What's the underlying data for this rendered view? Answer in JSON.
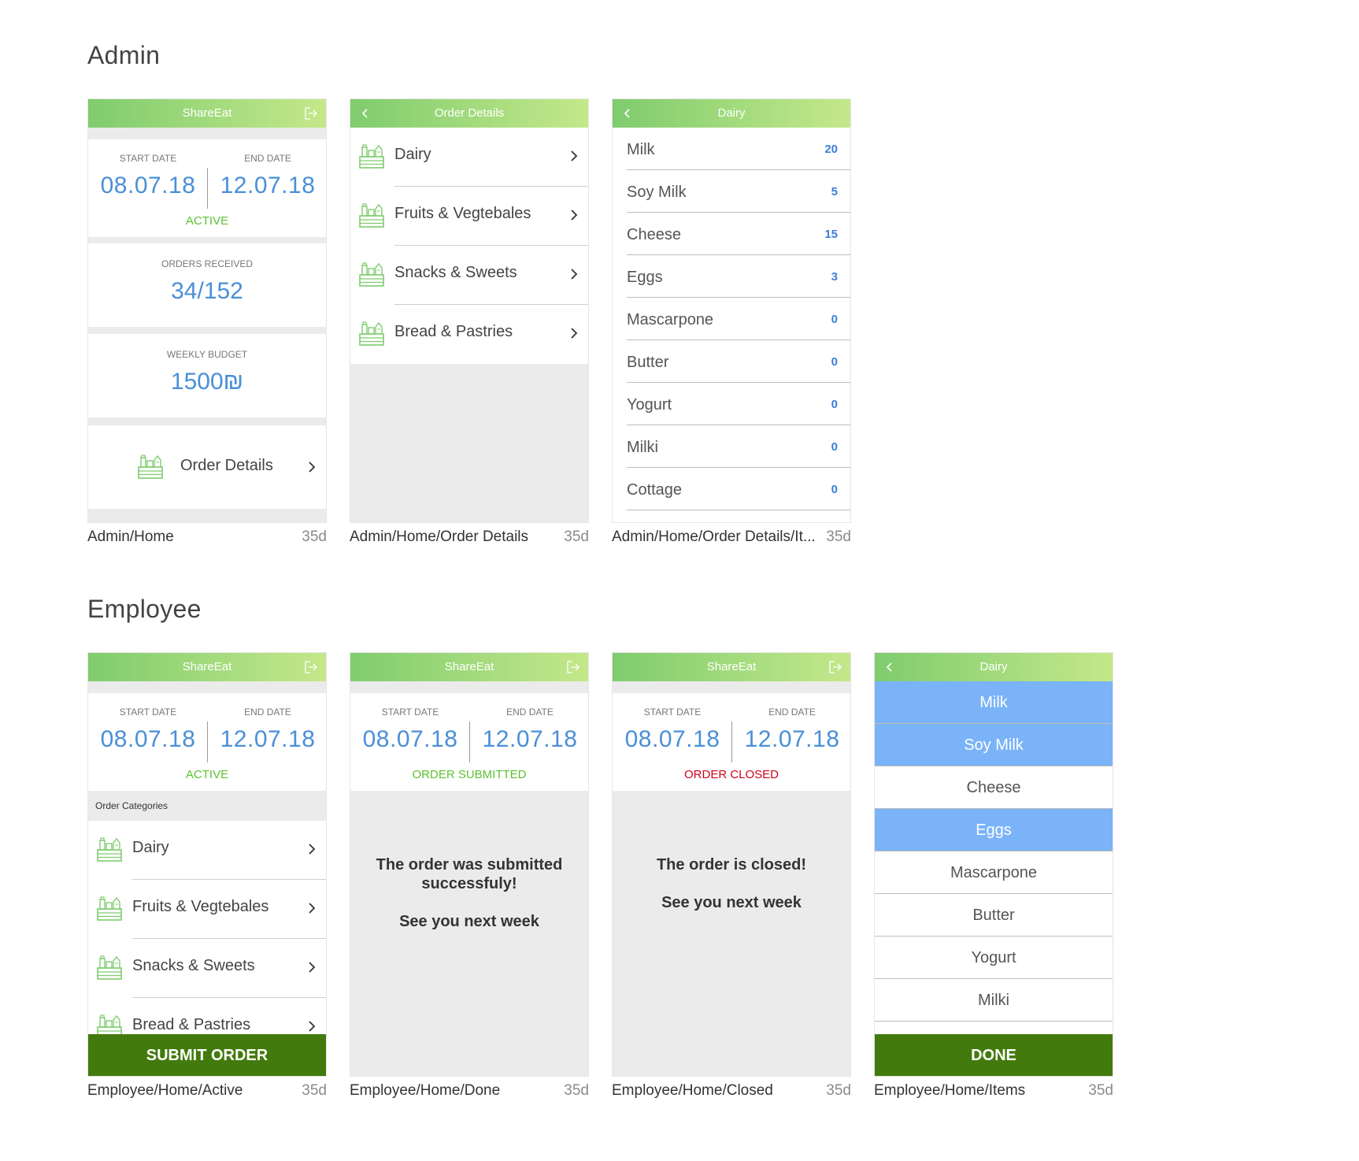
{
  "sections": {
    "admin": "Admin",
    "employee": "Employee"
  },
  "common": {
    "app_title": "ShareEat",
    "start_date_label": "START DATE",
    "end_date_label": "END DATE",
    "start_date": "08.07.18",
    "end_date": "12.07.18",
    "age": "35d"
  },
  "colors": {
    "accent_blue": "#4a8fd8",
    "active_green": "#5cc232",
    "closed_red": "#d0021b",
    "button_green": "#437a0d",
    "selected_blue": "#7ab3f8"
  },
  "admin_home": {
    "label": "Admin/Home",
    "status": "ACTIVE",
    "orders_received_label": "ORDERS RECEIVED",
    "orders_received": "34/152",
    "weekly_budget_label": "WEEKLY BUDGET",
    "weekly_budget": "1500₪",
    "order_details": "Order Details"
  },
  "admin_order_details": {
    "label": "Admin/Home/Order Details",
    "title": "Order Details",
    "categories": [
      "Dairy",
      "Fruits & Vegtebales",
      "Snacks & Sweets",
      "Bread & Pastries"
    ]
  },
  "admin_items": {
    "label": "Admin/Home/Order Details/It...",
    "title": "Dairy",
    "items": [
      {
        "name": "Milk",
        "qty": "20"
      },
      {
        "name": "Soy Milk",
        "qty": "5"
      },
      {
        "name": "Cheese",
        "qty": "15"
      },
      {
        "name": "Eggs",
        "qty": "3"
      },
      {
        "name": "Mascarpone",
        "qty": "0"
      },
      {
        "name": "Butter",
        "qty": "0"
      },
      {
        "name": "Yogurt",
        "qty": "0"
      },
      {
        "name": "Milki",
        "qty": "0"
      },
      {
        "name": "Cottage",
        "qty": "0"
      }
    ]
  },
  "employee_active": {
    "label": "Employee/Home/Active",
    "status": "ACTIVE",
    "categories_header": "Order Categories",
    "categories": [
      "Dairy",
      "Fruits & Vegtebales",
      "Snacks & Sweets",
      "Bread & Pastries"
    ],
    "submit": "SUBMIT ORDER"
  },
  "employee_done": {
    "label": "Employee/Home/Done",
    "status": "ORDER SUBMITTED",
    "msg_line1": "The order was submitted",
    "msg_line2": "successfuly!",
    "msg_line3": "See you next week"
  },
  "employee_closed": {
    "label": "Employee/Home/Closed",
    "status": "ORDER CLOSED",
    "msg_line1": "The order is closed!",
    "msg_line2": "See you next week"
  },
  "employee_items": {
    "label": "Employee/Home/Items",
    "title": "Dairy",
    "items": [
      {
        "name": "Milk",
        "selected": true
      },
      {
        "name": "Soy Milk",
        "selected": true
      },
      {
        "name": "Cheese",
        "selected": false
      },
      {
        "name": "Eggs",
        "selected": true
      },
      {
        "name": "Mascarpone",
        "selected": false
      },
      {
        "name": "Butter",
        "selected": false
      },
      {
        "name": "Yogurt",
        "selected": false
      },
      {
        "name": "Milki",
        "selected": false
      }
    ],
    "done": "DONE"
  }
}
